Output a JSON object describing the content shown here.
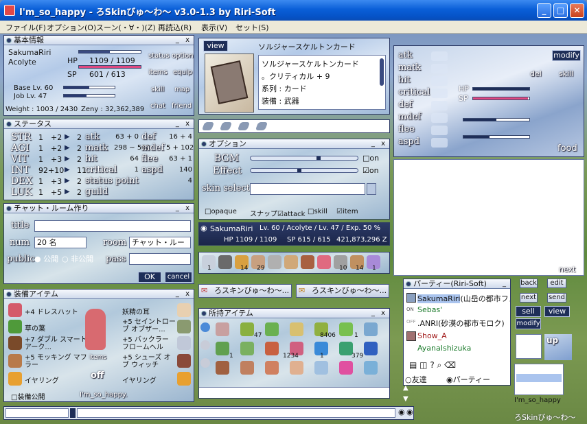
{
  "window": {
    "title": "I'm_so_happy - ろSkinびゅ～わ～ v3.0-1.3 by Riri-Soft",
    "min": "_",
    "max": "□",
    "close": "✕"
  },
  "menu": [
    "ファイル(F)",
    "オプション(O)",
    "スーン(・∀・)(Z)",
    "再読込(R)",
    "表示(V)",
    "セット(S)"
  ],
  "basic": {
    "title": "基本情報",
    "name": "SakumaRiri",
    "job": "Acolyte",
    "hp_label": "HP",
    "hp": "1109 / 1109",
    "sp_label": "SP",
    "sp": "601 / 613",
    "base": "Base Lv. 60",
    "joblv": "Job Lv. 47",
    "weight": "Weight : 1003 / 2430",
    "zeny": "Zeny : 32,362,389",
    "buttons": [
      "status",
      "option",
      "items",
      "equip",
      "skill",
      "map",
      "chat",
      "friend"
    ]
  },
  "status": {
    "title": "ステータス",
    "stats": [
      {
        "n": "STR",
        "b": "1",
        "p": "+2",
        "c": "2"
      },
      {
        "n": "AGI",
        "b": "1",
        "p": "+2",
        "c": "2"
      },
      {
        "n": "VIT",
        "b": "1",
        "p": "+3",
        "c": "2"
      },
      {
        "n": "INT",
        "b": "92+10",
        "p": "",
        "c": "11"
      },
      {
        "n": "DEX",
        "b": "1",
        "p": "+3",
        "c": "2"
      },
      {
        "n": "LUK",
        "b": "1",
        "p": "+5",
        "c": "2"
      }
    ],
    "mid": [
      {
        "k": "atk",
        "v": "63 + 0"
      },
      {
        "k": "matk",
        "v": "298 ~ 502"
      },
      {
        "k": "hit",
        "v": "64"
      },
      {
        "k": "critical",
        "v": "1"
      },
      {
        "k": "status point",
        "v": ""
      },
      {
        "k": "guild",
        "v": ""
      }
    ],
    "right": [
      {
        "k": "def",
        "v": "16 + 4"
      },
      {
        "k": "mdef",
        "v": "5 + 102"
      },
      {
        "k": "flee",
        "v": "63 + 1"
      },
      {
        "k": "aspd",
        "v": "140"
      },
      {
        "k": "",
        "v": "4"
      }
    ]
  },
  "chat": {
    "title": "チャット・ルーム作り",
    "title_label": "title",
    "num_label": "num",
    "num_value": "20 名",
    "room_label": "room",
    "room_value": "チャット・ルー",
    "public_label": "public",
    "opt_public": "公開",
    "opt_private": "非公開",
    "pass_label": "pass",
    "ok": "OK",
    "cancel": "cancel"
  },
  "equip": {
    "title": "装備アイテム",
    "left": [
      "+4 ドレスハット",
      "草の葉",
      "+7 ダブル スマート アーク...",
      "+5 モッキング マフラー",
      "イヤリング"
    ],
    "right": [
      "妖精の耳",
      "+5 セイントロー ブ オブザー...",
      "+5 バックラー フロームヘル",
      "+5 シューズ オブ ウィッチ",
      "イヤリング"
    ],
    "items_btn": "items",
    "off": "off",
    "public_label": "装備公開",
    "char_name": "I'm_so_happy."
  },
  "card": {
    "view": "view",
    "title": "ソルジャースケルトンカード",
    "lines": [
      "ソルジャースケルトンカード",
      "。クリティカル + 9",
      "系列 : カード",
      "装備 : 武器"
    ]
  },
  "options": {
    "title": "オプション",
    "bgm": "BGM",
    "effect": "Effect",
    "on": "on",
    "skin_select": "skin select",
    "opaque": "opaque",
    "snap": "スナップ",
    "attack": "attack",
    "skill": "skill",
    "item": "item"
  },
  "char_bar": {
    "name": "SakumaRiri",
    "info": "Lv. 60 / Acolyte / Lv. 47 / Exp. 50 %",
    "hp": "HP 1109 / 1109",
    "sp": "SP 615 / 615",
    "zeny": "421,873,296 Z"
  },
  "hotbar": {
    "counts": [
      "1",
      "",
      "14",
      "29",
      "",
      "",
      "",
      "",
      "10",
      "14",
      "1"
    ]
  },
  "skin_buttons": [
    "ろスキンびゅ～わ～...",
    "ろスキンびゅ～わ～..."
  ],
  "inventory": {
    "title": "所持アイテム",
    "counts_row1": [
      "",
      "47",
      "",
      "8406",
      "1"
    ],
    "counts_row2": [
      "1",
      "",
      "1234",
      "1",
      "379"
    ]
  },
  "party": {
    "title": "パーティー(Riri-Soft)",
    "members": [
      {
        "n": "SakumaRiri",
        "m": "(山岳の都市フェ"
      },
      {
        "n": "Sebas'",
        "m": ""
      },
      {
        "n": ".ANRI",
        "m": "(砂漠の都市モロク)"
      },
      {
        "n": "Show_A",
        "m": ""
      },
      {
        "n": "AyanaIshizuka",
        "m": ""
      }
    ],
    "radio_friend": "友達",
    "radio_party": "パーティー"
  },
  "status_right": {
    "stats": [
      "atk",
      "matk",
      "hit",
      "critical",
      "def",
      "mdef",
      "flee",
      "aspd"
    ],
    "hp": "HP",
    "sp": "SP",
    "modify": "modify",
    "del": "del",
    "skill": "skill",
    "food": "food",
    "next": "next"
  },
  "chat_right": {
    "back": "back",
    "edit": "edit",
    "next": "next",
    "send": "send",
    "sell": "sell",
    "view": "view",
    "modify": "modify",
    "up": "up",
    "name": "I'm_so_happy",
    "footer": "ろSkinびゅ～わ～"
  }
}
